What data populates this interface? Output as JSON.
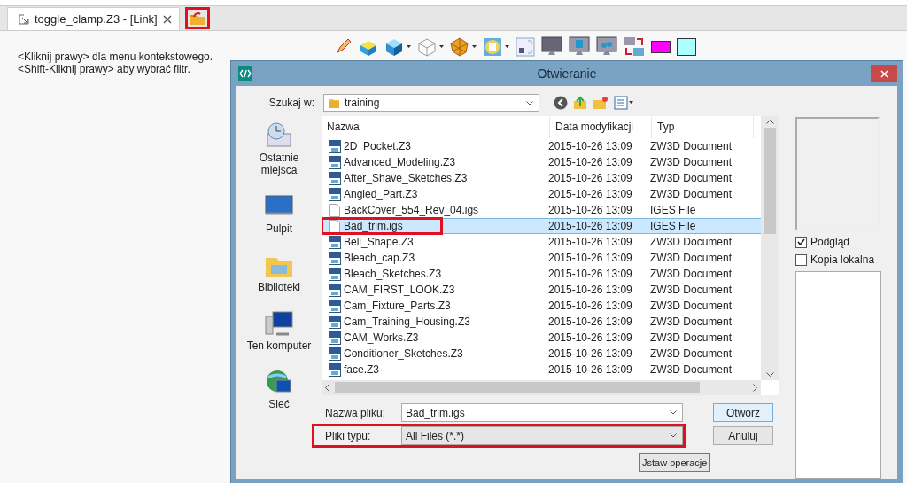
{
  "tab_bar": {
    "tabs": [
      {
        "label": "toggle_clamp.Z3 - [Link]",
        "selected": true
      }
    ],
    "open_button": {
      "highlighted": true
    }
  },
  "hint_lines": [
    "<Kliknij prawy> dla menu kontekstowego.",
    "<Shift-Kliknij prawy> aby wybrać filtr."
  ],
  "toolbar": {
    "swatches": [
      {
        "color": "#ff00ff"
      },
      {
        "color": "#aaffff"
      }
    ]
  },
  "dialog": {
    "title": "Otwieranie",
    "look_in": {
      "label": "Szukaj w:",
      "value": "training"
    },
    "places": [
      {
        "kind": "recent",
        "label": "Ostatnie miejsca"
      },
      {
        "kind": "desktop",
        "label": "Pulpit"
      },
      {
        "kind": "libraries",
        "label": "Biblioteki"
      },
      {
        "kind": "computer",
        "label": "Ten komputer"
      },
      {
        "kind": "network",
        "label": "Sieć"
      }
    ],
    "file_list": {
      "columns": [
        "Nazwa",
        "Data modyfikacji",
        "Typ"
      ],
      "rows": [
        {
          "kind": "z3",
          "name": "2D_Pocket.Z3",
          "date": "2015-10-26 13:09",
          "type": "ZW3D Document",
          "selected": false,
          "highlighted": false
        },
        {
          "kind": "z3",
          "name": "Advanced_Modeling.Z3",
          "date": "2015-10-26 13:09",
          "type": "ZW3D Document",
          "selected": false,
          "highlighted": false
        },
        {
          "kind": "z3",
          "name": "After_Shave_Sketches.Z3",
          "date": "2015-10-26 13:09",
          "type": "ZW3D Document",
          "selected": false,
          "highlighted": false
        },
        {
          "kind": "z3",
          "name": "Angled_Part.Z3",
          "date": "2015-10-26 13:09",
          "type": "ZW3D Document",
          "selected": false,
          "highlighted": false
        },
        {
          "kind": "igs",
          "name": "BackCover_554_Rev_04.igs",
          "date": "2015-10-26 13:09",
          "type": "IGES File",
          "selected": false,
          "highlighted": false
        },
        {
          "kind": "igs",
          "name": "Bad_trim.igs",
          "date": "2015-10-26 13:09",
          "type": "IGES File",
          "selected": true,
          "highlighted": true
        },
        {
          "kind": "z3",
          "name": "Bell_Shape.Z3",
          "date": "2015-10-26 13:09",
          "type": "ZW3D Document",
          "selected": false,
          "highlighted": false
        },
        {
          "kind": "z3",
          "name": "Bleach_cap.Z3",
          "date": "2015-10-26 13:09",
          "type": "ZW3D Document",
          "selected": false,
          "highlighted": false
        },
        {
          "kind": "z3",
          "name": "Bleach_Sketches.Z3",
          "date": "2015-10-26 13:09",
          "type": "ZW3D Document",
          "selected": false,
          "highlighted": false
        },
        {
          "kind": "z3",
          "name": "CAM_FIRST_LOOK.Z3",
          "date": "2015-10-26 13:09",
          "type": "ZW3D Document",
          "selected": false,
          "highlighted": false
        },
        {
          "kind": "z3",
          "name": "Cam_Fixture_Parts.Z3",
          "date": "2015-10-26 13:09",
          "type": "ZW3D Document",
          "selected": false,
          "highlighted": false
        },
        {
          "kind": "z3",
          "name": "Cam_Training_Housing.Z3",
          "date": "2015-10-26 13:09",
          "type": "ZW3D Document",
          "selected": false,
          "highlighted": false
        },
        {
          "kind": "z3",
          "name": "CAM_Works.Z3",
          "date": "2015-10-26 13:09",
          "type": "ZW3D Document",
          "selected": false,
          "highlighted": false
        },
        {
          "kind": "z3",
          "name": "Conditioner_Sketches.Z3",
          "date": "2015-10-26 13:09",
          "type": "ZW3D Document",
          "selected": false,
          "highlighted": false
        },
        {
          "kind": "z3",
          "name": "face.Z3",
          "date": "2015-10-26 13:09",
          "type": "ZW3D Document",
          "selected": false,
          "highlighted": false
        }
      ]
    },
    "preview_checks": [
      {
        "label": "Podgląd",
        "checked": true
      },
      {
        "label": "Kopia lokalna",
        "checked": false
      }
    ],
    "file_name": {
      "label": "Nazwa pliku:",
      "value": "Bad_trim.igs"
    },
    "file_type": {
      "label": "Pliki typu:",
      "value": "All Files (*.*)",
      "highlighted": true
    },
    "buttons": [
      {
        "label": "Otwórz",
        "default": true
      },
      {
        "label": "Anuluj",
        "default": false
      }
    ],
    "operation_button": {
      "label": "Jstaw operacje"
    }
  }
}
